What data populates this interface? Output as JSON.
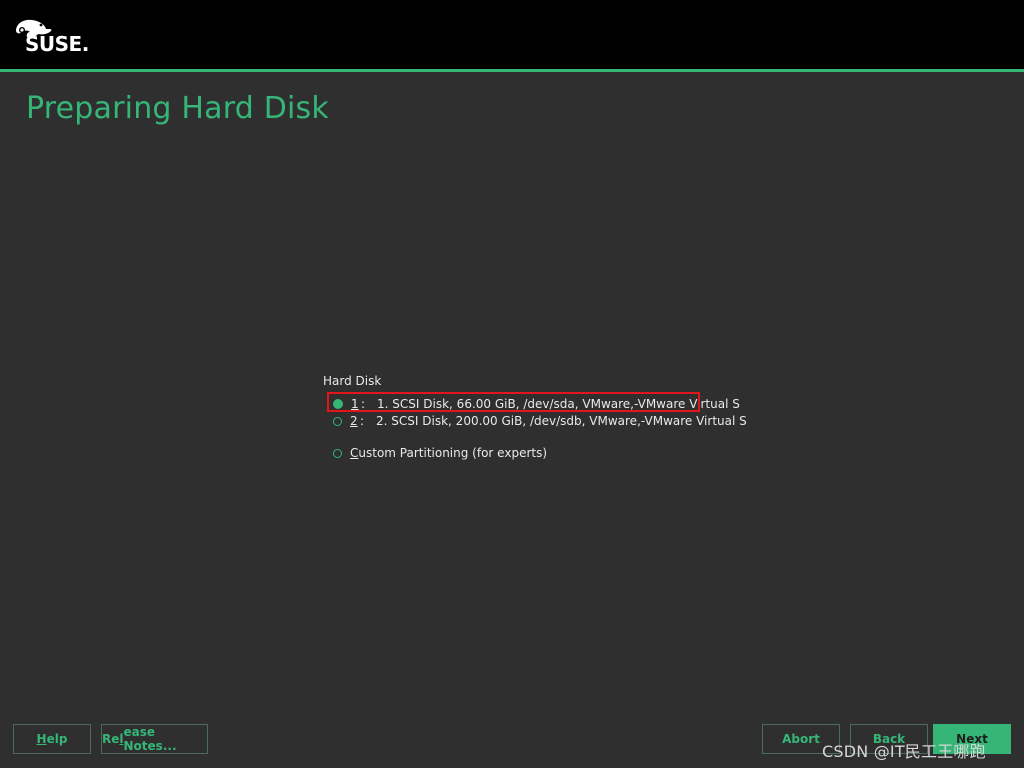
{
  "app": {
    "brand": "SUSE.",
    "accent_color": "#35b677",
    "background_color": "#2f2f2f",
    "header_color": "#000000"
  },
  "page": {
    "title": "Preparing Hard Disk"
  },
  "hard_disk": {
    "group_label": "Hard Disk",
    "options": [
      {
        "key": "1",
        "text": "1. SCSI Disk, 66.00 GiB, /dev/sda, VMware,-VMware Virtual S",
        "selected": true
      },
      {
        "key": "2",
        "text": "2. SCSI Disk, 200.00 GiB, /dev/sdb, VMware,-VMware Virtual S",
        "selected": false
      }
    ],
    "custom": {
      "key": "C",
      "label_rest": "ustom Partitioning (for experts)",
      "selected": false
    },
    "highlight_color": "#e0161a"
  },
  "buttons": {
    "help": {
      "key": "H",
      "rest": "elp"
    },
    "release_notes": {
      "pre": "Re",
      "key": "l",
      "rest": "ease Notes..."
    },
    "abort": {
      "label": "Abort"
    },
    "back": {
      "label": "Back"
    },
    "next": {
      "label": "Next"
    }
  },
  "watermark": "CSDN @IT民工王哪跑"
}
